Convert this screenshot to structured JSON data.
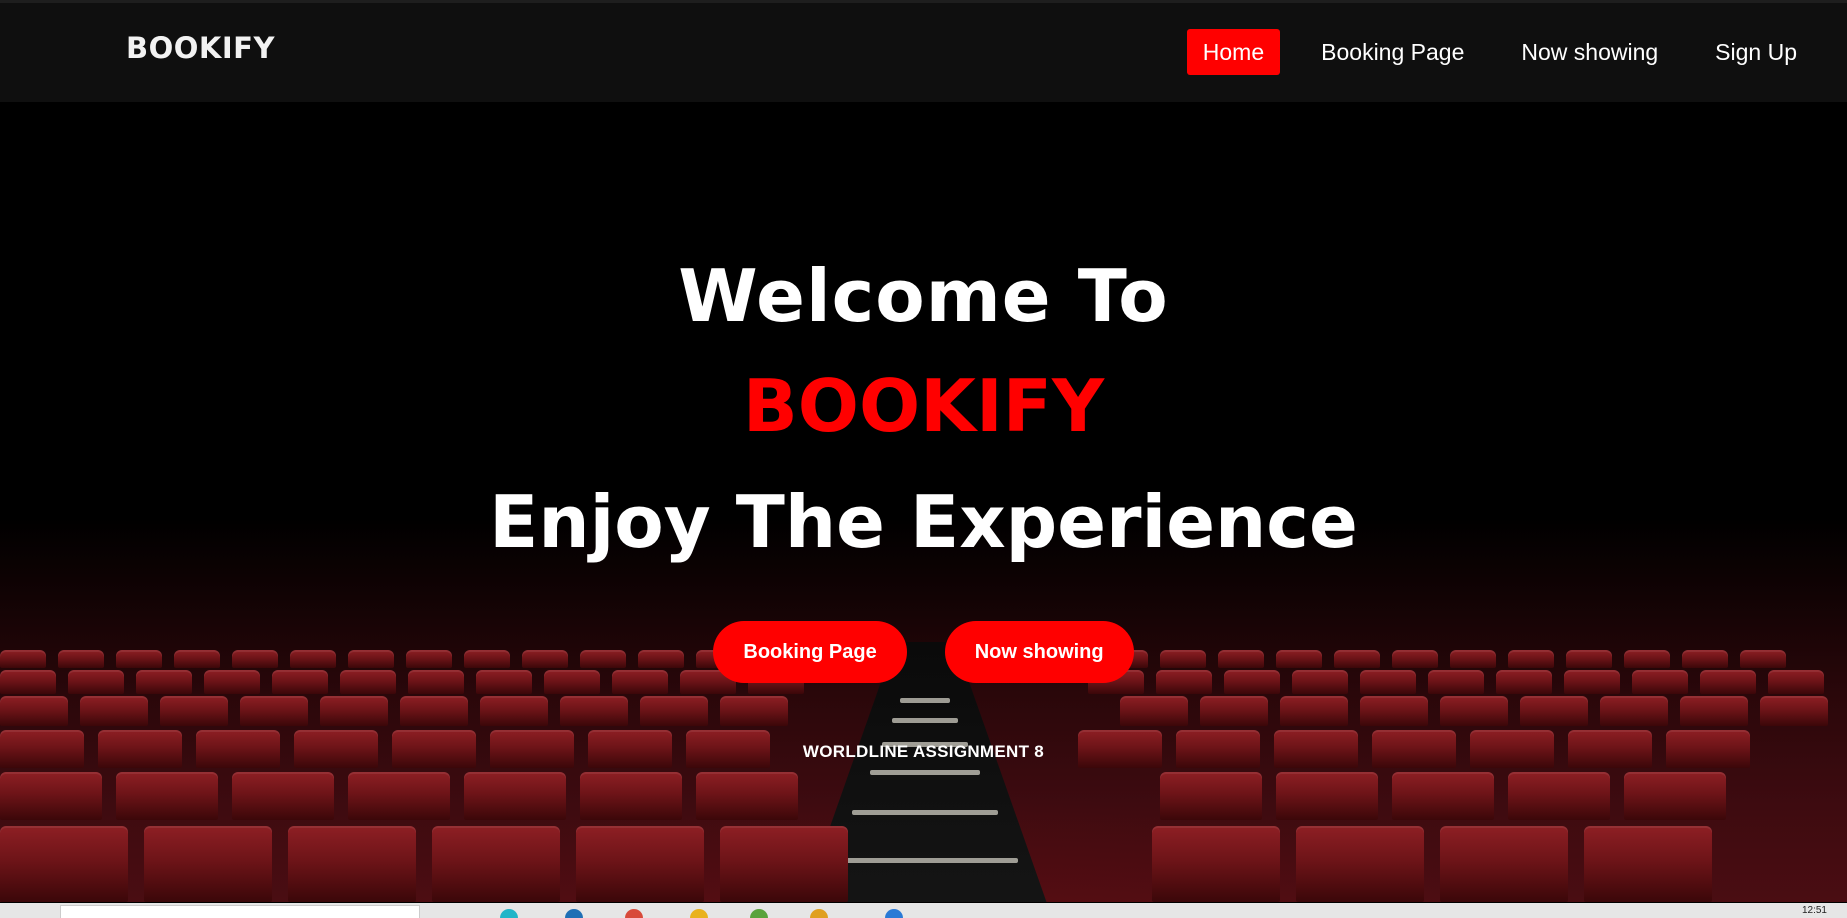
{
  "navbar": {
    "brand": "BOOKIFY",
    "links": [
      {
        "label": "Home",
        "active": true
      },
      {
        "label": "Booking Page",
        "active": false
      },
      {
        "label": "Now showing",
        "active": false
      },
      {
        "label": "Sign Up",
        "active": false
      }
    ]
  },
  "hero": {
    "line1": "Welcome To",
    "line2": "BOOKIFY",
    "line3": "Enjoy The Experience",
    "buttons": [
      {
        "label": "Booking Page"
      },
      {
        "label": "Now showing"
      }
    ],
    "tagline": "WORLDLINE ASSIGNMENT 8"
  },
  "taskbar": {
    "time": "12:51"
  },
  "colors": {
    "accent": "#ff0000",
    "navbar": "#0f0f0f",
    "background": "#000000",
    "seat": "#7a161b"
  }
}
